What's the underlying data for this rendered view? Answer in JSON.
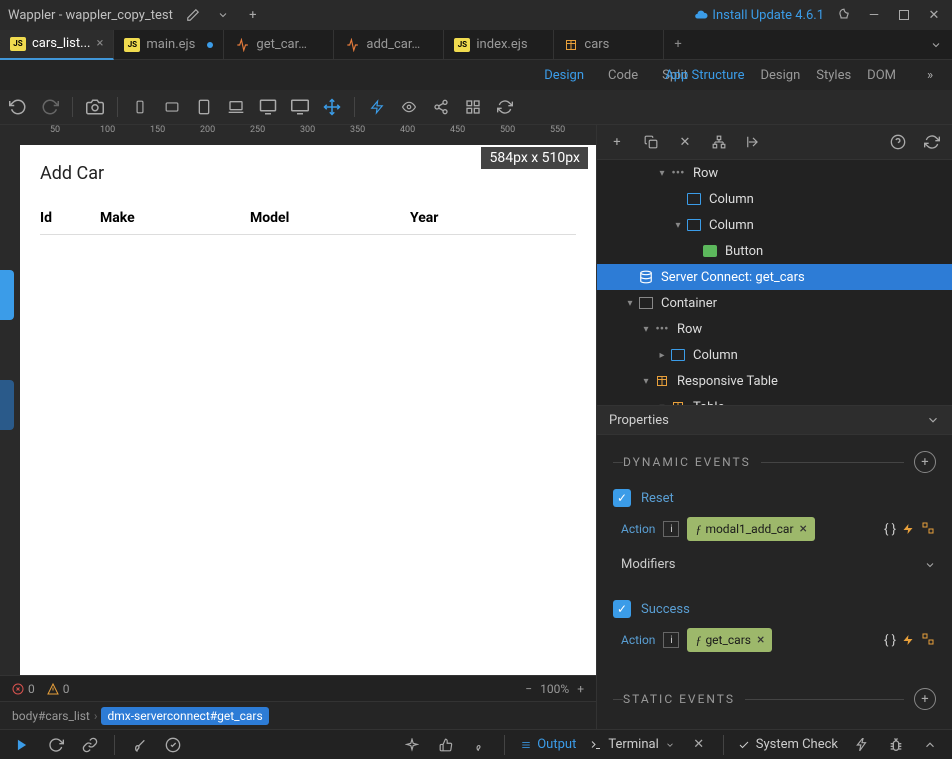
{
  "titlebar": {
    "app": "Wappler",
    "project": "wappler_copy_test",
    "update_text": "Install Update 4.6.1"
  },
  "tabs": [
    {
      "label": "cars_list...",
      "icon": "js",
      "active": true,
      "closable": true
    },
    {
      "label": "main.ejs",
      "icon": "js",
      "active": false,
      "modified": true
    },
    {
      "label": "get_car…",
      "icon": "api",
      "active": false
    },
    {
      "label": "add_car…",
      "icon": "api",
      "active": false
    },
    {
      "label": "index.ejs",
      "icon": "js",
      "active": false
    },
    {
      "label": "cars",
      "icon": "db",
      "active": false
    }
  ],
  "view_tabs": {
    "design": "Design",
    "code": "Code",
    "split": "Split"
  },
  "right_tabs": {
    "app_structure": "App Structure",
    "design": "Design",
    "styles": "Styles",
    "dom": "DOM"
  },
  "canvas": {
    "dims": "584px x 510px",
    "heading": "Add Car",
    "columns": {
      "id": "Id",
      "make": "Make",
      "model": "Model",
      "year": "Year"
    }
  },
  "ruler_marks": [
    "50",
    "100",
    "150",
    "200",
    "250",
    "300",
    "350",
    "400",
    "450",
    "500",
    "550"
  ],
  "tree": [
    {
      "indent": 3,
      "label": "Row",
      "icon": "row",
      "chev": "down"
    },
    {
      "indent": 4,
      "label": "Column",
      "icon": "col",
      "chev": ""
    },
    {
      "indent": 4,
      "label": "Column",
      "icon": "col",
      "chev": "down"
    },
    {
      "indent": 5,
      "label": "Button",
      "icon": "btn",
      "chev": ""
    },
    {
      "indent": 1,
      "label": "Server Connect: get_cars",
      "icon": "db",
      "selected": true
    },
    {
      "indent": 1,
      "label": "Container",
      "icon": "cont",
      "chev": "down"
    },
    {
      "indent": 2,
      "label": "Row",
      "icon": "row",
      "chev": "down"
    },
    {
      "indent": 3,
      "label": "Column",
      "icon": "col",
      "chev": "right"
    },
    {
      "indent": 2,
      "label": "Responsive Table",
      "icon": "tbl",
      "chev": "down"
    },
    {
      "indent": 3,
      "label": "Table",
      "icon": "tbl",
      "chev": "down"
    }
  ],
  "properties": {
    "header": "Properties",
    "dynamic_events": "DYNAMIC EVENTS",
    "static_events": "STATIC EVENTS",
    "events": [
      {
        "name": "Reset",
        "action_label": "Action",
        "pill": "modal1_add_car",
        "has_modifiers": true
      },
      {
        "name": "Success",
        "action_label": "Action",
        "pill": "get_cars",
        "has_modifiers": false
      }
    ],
    "modifiers_label": "Modifiers"
  },
  "status": {
    "errors": "0",
    "warnings": "0",
    "zoom": "100%"
  },
  "breadcrumb": {
    "body": "body#cars_list",
    "current": "dmx-serverconnect#get_cars"
  },
  "bottom": {
    "output": "Output",
    "terminal": "Terminal",
    "system_check": "System Check"
  }
}
